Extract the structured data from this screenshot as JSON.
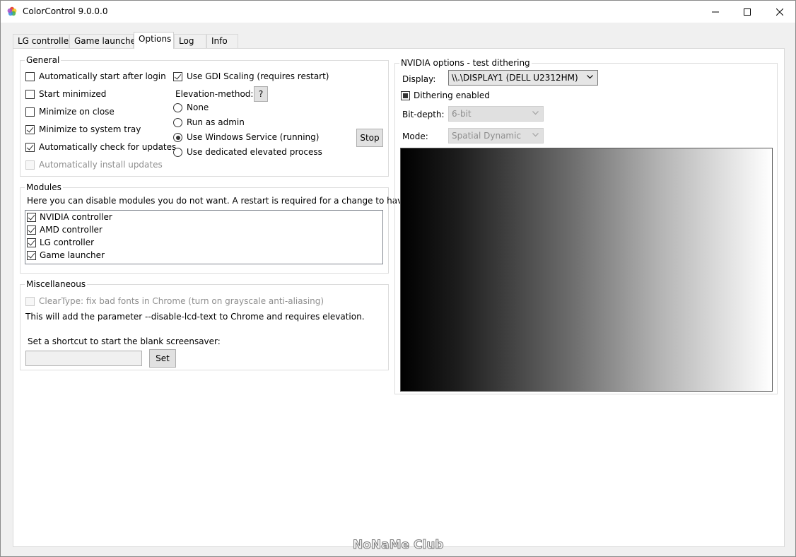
{
  "window": {
    "title": "ColorControl 9.0.0.0"
  },
  "tabs": [
    "LG controller",
    "Game launcher",
    "Options",
    "Log",
    "Info"
  ],
  "general": {
    "title": "General",
    "auto_start": "Automatically start after login",
    "start_minimized": "Start minimized",
    "minimize_on_close": "Minimize on close",
    "minimize_to_tray": "Minimize to system tray",
    "auto_check_updates": "Automatically check for updates",
    "auto_install_updates": "Automatically install updates",
    "gdi_scaling": "Use GDI Scaling (requires restart)",
    "elevation_label": "Elevation-method:",
    "help_button": "?",
    "radio_none": "None",
    "radio_admin": "Run as admin",
    "radio_service": "Use Windows Service (running)",
    "radio_dedicated": "Use dedicated elevated process",
    "stop_button": "Stop"
  },
  "modules": {
    "title": "Modules",
    "description": "Here you can disable modules you do not want. A restart is required for a change to have effect.",
    "items": [
      "NVIDIA controller",
      "AMD controller",
      "LG controller",
      "Game launcher"
    ]
  },
  "misc": {
    "title": "Miscellaneous",
    "cleartype": "ClearType: fix bad fonts in Chrome (turn on grayscale anti-aliasing)",
    "note": "This will add the parameter --disable-lcd-text to Chrome and requires elevation.",
    "shortcut_label": "Set a shortcut to start the blank screensaver:",
    "shortcut_value": "",
    "set_button": "Set"
  },
  "nvidia": {
    "title": "NVIDIA options - test dithering",
    "display_label": "Display:",
    "display_value": "\\\\.\\DISPLAY1 (DELL U2312HM)",
    "dithering_label": "Dithering enabled",
    "bitdepth_label": "Bit-depth:",
    "bitdepth_value": "6-bit",
    "mode_label": "Mode:",
    "mode_value": "Spatial Dynamic"
  },
  "watermark": "NoNaMe Club"
}
